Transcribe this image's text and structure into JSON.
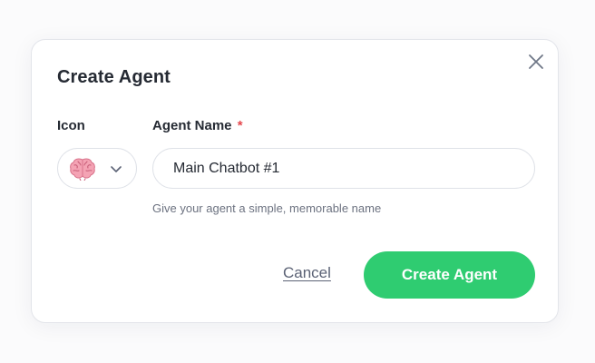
{
  "dialog": {
    "title": "Create Agent",
    "close_icon": "close-icon"
  },
  "icon_field": {
    "label": "Icon",
    "selected_icon": "brain-icon",
    "dropdown_icon": "chevron-down-icon"
  },
  "name_field": {
    "label": "Agent Name",
    "required_marker": "*",
    "value": "Main Chatbot #1",
    "helper": "Give your agent a simple, memorable name"
  },
  "actions": {
    "cancel_label": "Cancel",
    "create_label": "Create Agent"
  },
  "colors": {
    "primary": "#2fcc71",
    "required": "#e5484d",
    "text": "#252a33",
    "muted": "#6c7280"
  }
}
